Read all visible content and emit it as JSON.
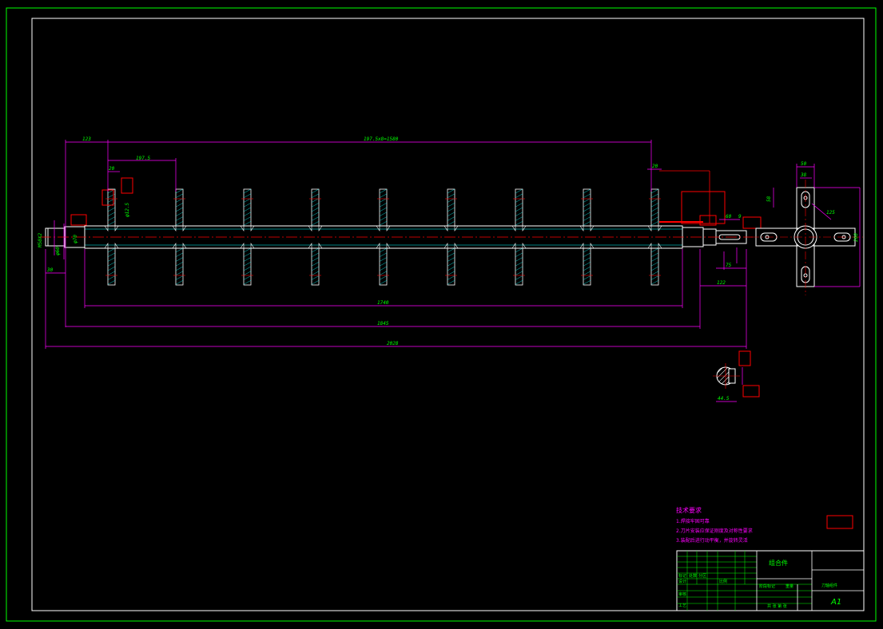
{
  "drawing": {
    "dims": {
      "d123": "123",
      "d197x8": "197.5x8=1580",
      "d197": "197.5",
      "d20a": "20",
      "d20b": "20",
      "d12": "φ12.5",
      "d1740": "1740",
      "d1845": "1845",
      "d2028": "2028",
      "d30": "30",
      "d122": "122",
      "d75": "75",
      "d60": "60",
      "d9": "9",
      "d50": "50",
      "d38": "38",
      "d58": "58",
      "d125": "125",
      "d260": "260",
      "d445": "44.5",
      "dM50": "M50X2",
      "dphi70": "φ70",
      "dphi60": "φ60"
    },
    "tech_title": "技术要求",
    "tech_notes": [
      "1.焊接牢固可靠",
      "2.刀片安装应保证刚度及对称性要求",
      "3.装配后进行动平衡，并旋转灵活"
    ]
  },
  "title_block": {
    "part_title": "组合件",
    "part_name": "刀轴组件",
    "sheet": "A1",
    "row_labels": [
      "标记",
      "处数",
      "分区"
    ],
    "sign_labels": [
      "设计",
      "审核",
      "工艺"
    ],
    "scale_label": "比例",
    "misc": [
      "阶段标记",
      "重量",
      "共 张 第 张"
    ]
  },
  "colors": {
    "border": "#00ff00",
    "part": "#ffffff",
    "dimension": "#ff00ff",
    "centerline": "#ff0000",
    "text": "#00ff00"
  }
}
